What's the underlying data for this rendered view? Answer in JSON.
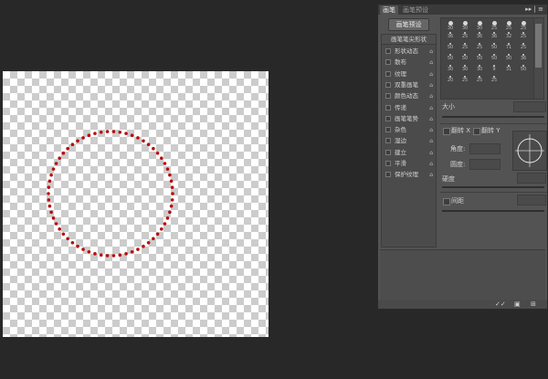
{
  "panel": {
    "tabs": [
      "画笔",
      "画笔预设"
    ],
    "menu_label": "▸▸ | ≡",
    "preset_button": "画笔预设"
  },
  "brush_list": {
    "header": "画笔笔尖形状",
    "items": [
      {
        "label": "形状动态",
        "lock": "⌂"
      },
      {
        "label": "散布",
        "lock": "⌂"
      },
      {
        "label": "纹理",
        "lock": "⌂"
      },
      {
        "label": "双重画笔",
        "lock": "⌂"
      },
      {
        "label": "颜色动态",
        "lock": "⌂"
      },
      {
        "label": "传递",
        "lock": "⌂"
      },
      {
        "label": "画笔笔势",
        "lock": "⌂"
      },
      {
        "label": "杂色",
        "lock": "⌂"
      },
      {
        "label": "湿边",
        "lock": "⌂"
      },
      {
        "label": "建立",
        "lock": "⌂"
      },
      {
        "label": "平滑",
        "lock": "⌂"
      },
      {
        "label": "保护纹理",
        "lock": "⌂"
      }
    ]
  },
  "tips": {
    "sizes": [
      "30",
      "30",
      "30",
      "25",
      "25",
      "25",
      "36",
      "25",
      "36",
      "36",
      "32",
      "25",
      "50",
      "25",
      "25",
      "50",
      "71",
      "25",
      "50",
      "50",
      "50",
      "50",
      "50",
      "36",
      "30",
      "30",
      "30",
      "9",
      "31",
      "50",
      "20",
      "25",
      "25",
      "25"
    ]
  },
  "controls": {
    "size_label": "大小",
    "flip_x": "翻转 X",
    "flip_y": "翻转 Y",
    "angle_label": "角度:",
    "roundness_label": "圆度:",
    "hardness_label": "硬度",
    "spacing_label": "间距"
  },
  "bottom_icons": [
    "✓✓",
    "▣",
    "⊞"
  ],
  "colors": {
    "brush_dot": "#b80e0e",
    "panel_bg": "#535353",
    "workspace_bg": "#282828"
  }
}
